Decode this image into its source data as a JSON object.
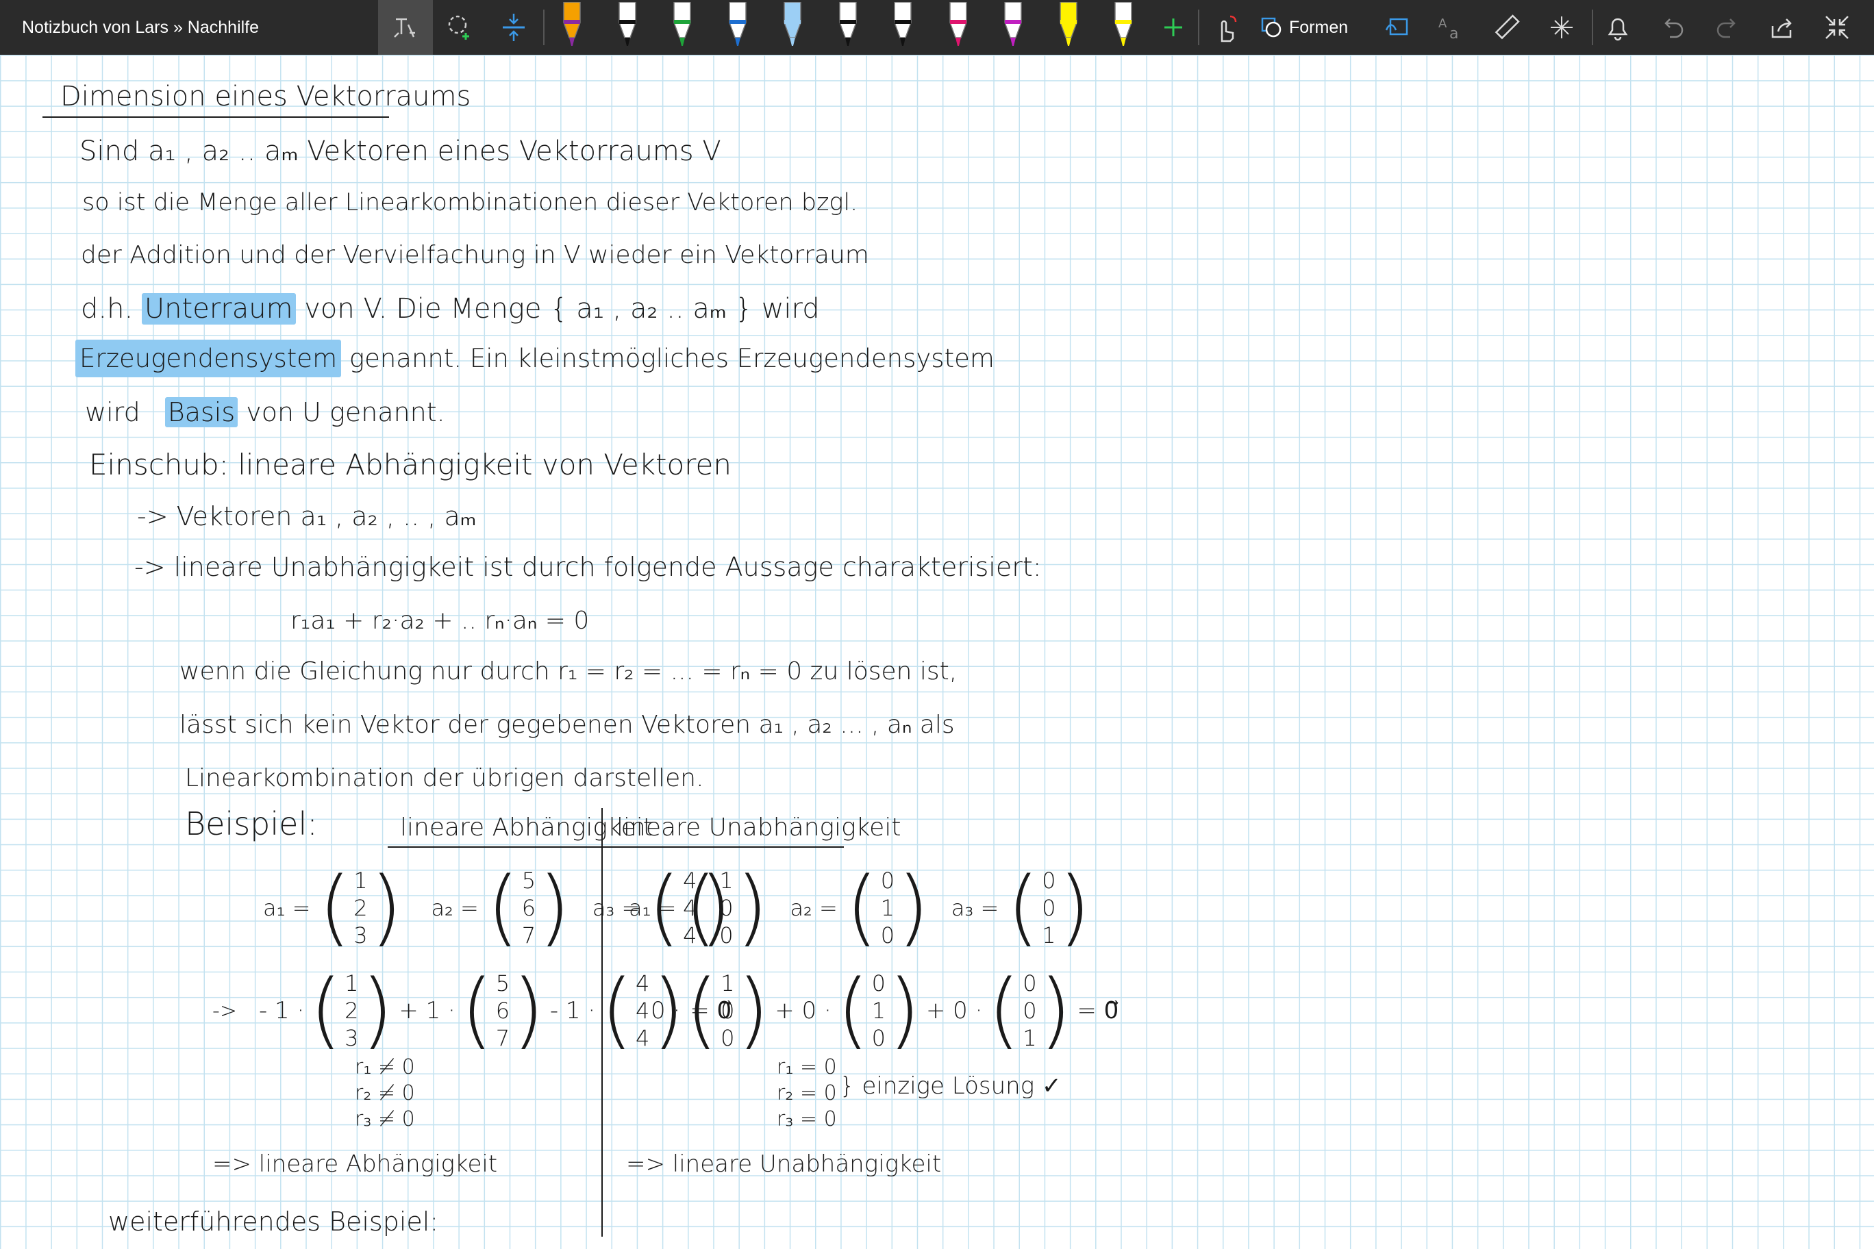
{
  "toolbar": {
    "breadcrumb": "Notizbuch von Lars » Nachhilfe",
    "shapes_label": "Formen",
    "pens": [
      {
        "color": "#f5a000",
        "tip": "#8a2aa0"
      },
      {
        "color": "#ffffff",
        "tip": "#111111"
      },
      {
        "color": "#ffffff",
        "tip": "#1fa43a"
      },
      {
        "color": "#ffffff",
        "tip": "#1e6fd0"
      },
      {
        "color": "#9ccff5",
        "tip": "#9ccff5"
      },
      {
        "color": "#ffffff",
        "tip": "#111111"
      },
      {
        "color": "#ffffff",
        "tip": "#111111"
      },
      {
        "color": "#ffffff",
        "tip": "#e0156e"
      },
      {
        "color": "#ffffff",
        "tip": "#c020c0"
      },
      {
        "color": "#fff200",
        "tip": "#fff200"
      },
      {
        "color": "#ffffff",
        "tip": "#fff200"
      }
    ]
  },
  "note": {
    "title": "Dimension eines Vektorraums",
    "line1": "Sind   a₁ , a₂ .. aₘ   Vektoren eines Vektorraums V",
    "line2": "so ist die  Menge aller Linearkombinationen dieser Vektoren bzgl.",
    "line3": "der Addition und der Vervielfachung in V wieder ein Vektorraum",
    "line4_pre": "d.h.",
    "line4_hl": "Unterraum",
    "line4_post": "von V.  Die Menge  { a₁ , a₂ .. aₘ }  wird",
    "line5_hl": "Erzeugendensystem",
    "line5_post": "genannt. Ein kleinstmögliches  Erzeugendensystem",
    "line6_pre": "wird",
    "line6_hl": "Basis",
    "line6_post": "von U genannt.",
    "einschub": "Einschub:   lineare Abhängigkeit von Vektoren",
    "arrow1": "->   Vektoren   a₁ , a₂ , .. , aₘ",
    "arrow2": "->   lineare Unabhängigkeit ist durch folgende Aussage charakterisiert:",
    "equation": "r₁a₁  +  r₂·a₂ + .. rₙ·aₙ  = 0",
    "wenn": "wenn die Gleichung nur durch   r₁ = r₂ = ... = rₙ = 0   zu lösen ist,",
    "laesst": "lässt sich kein Vektor der gegebenen Vektoren  a₁ , a₂ ... , aₙ  als",
    "linear": "Linearkombination der übrigen darstellen.",
    "beispiel": "Beispiel:",
    "col_left_header": "lineare Abhängigkeit",
    "col_right_header": "lineare Unabhängigkeit",
    "left_defs": {
      "a1_label": "a₁ =",
      "a1": [
        "1",
        "2",
        "3"
      ],
      "a2_label": "a₂ =",
      "a2": [
        "5",
        "6",
        "7"
      ],
      "a3_label": "a₃ =",
      "a3": [
        "4",
        "4",
        "4"
      ]
    },
    "right_defs": {
      "a1_label": "a₁ =",
      "a1": [
        "1",
        "0",
        "0"
      ],
      "a2_label": "a₂ =",
      "a2": [
        "0",
        "1",
        "0"
      ],
      "a3_label": "a₃ =",
      "a3": [
        "0",
        "0",
        "1"
      ]
    },
    "left_combo": {
      "arrow": "->",
      "c1": "- 1 ·",
      "c2": "+ 1 ·",
      "c3": "- 1 ·",
      "result": "= 0⃗"
    },
    "right_combo": {
      "c1": "0 ·",
      "c2": "+ 0 ·",
      "c3": "+ 0 ·",
      "result": "= 0⃗"
    },
    "left_r": [
      "r₁ ≠ 0",
      "r₂ ≠ 0",
      "r₃ ≠ 0"
    ],
    "right_r": [
      "r₁ = 0",
      "r₂ = 0",
      "r₃ = 0"
    ],
    "right_brace_text": "} einzige Lösung ✓",
    "left_conclusion": "=>   lineare Abhängigkeit",
    "right_conclusion": "=>   lineare Unabhängigkeit",
    "weiter": "weiterführendes  Beispiel:"
  }
}
